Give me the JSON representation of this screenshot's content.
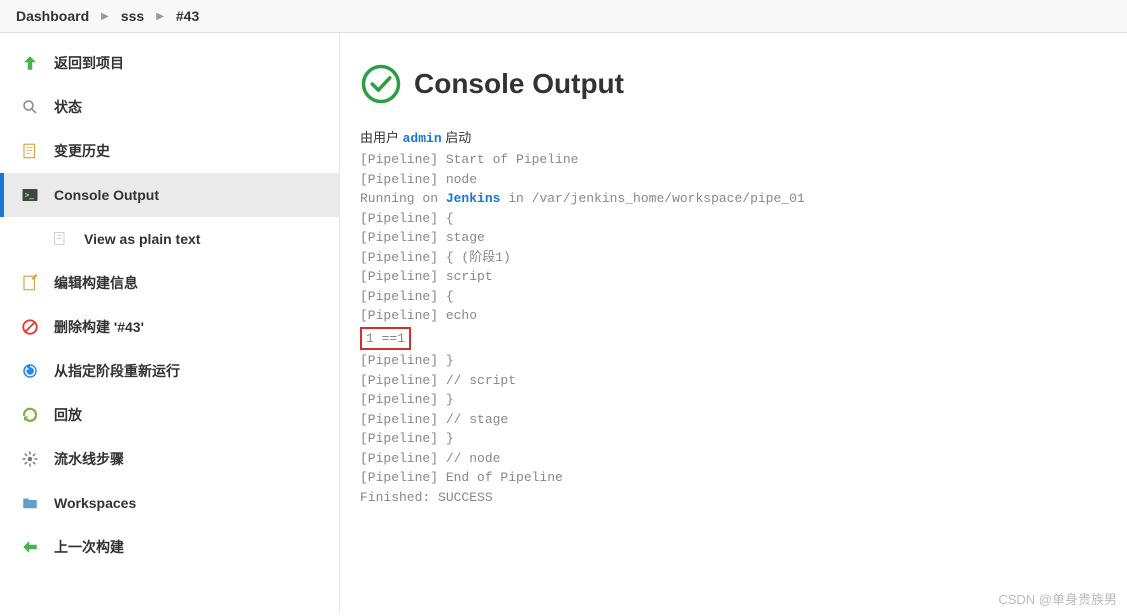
{
  "breadcrumb": [
    "Dashboard",
    "sss",
    "#43"
  ],
  "sidebar": {
    "items": [
      {
        "label": "返回到项目"
      },
      {
        "label": "状态"
      },
      {
        "label": "变更历史"
      },
      {
        "label": "Console Output"
      },
      {
        "label": "View as plain text"
      },
      {
        "label": "编辑构建信息"
      },
      {
        "label": "删除构建 '#43'"
      },
      {
        "label": "从指定阶段重新运行"
      },
      {
        "label": "回放"
      },
      {
        "label": "流水线步骤"
      },
      {
        "label": "Workspaces"
      },
      {
        "label": "上一次构建"
      }
    ]
  },
  "main": {
    "title": "Console Output",
    "start_prefix": "由用户 ",
    "start_user": "admin",
    "start_suffix": " 启动",
    "console_pre": "[Pipeline] Start of Pipeline\n[Pipeline] node",
    "running_prefix": "Running on ",
    "running_kw": "Jenkins",
    "running_suffix": " in /var/jenkins_home/workspace/pipe_01",
    "console_mid": "[Pipeline] {\n[Pipeline] stage\n[Pipeline] { (阶段1)\n[Pipeline] script\n[Pipeline] {\n[Pipeline] echo",
    "highlighted": "1 ==1",
    "console_post": "[Pipeline] }\n[Pipeline] // script\n[Pipeline] }\n[Pipeline] // stage\n[Pipeline] }\n[Pipeline] // node\n[Pipeline] End of Pipeline\nFinished: SUCCESS"
  },
  "watermark": "CSDN @单身贵族男"
}
